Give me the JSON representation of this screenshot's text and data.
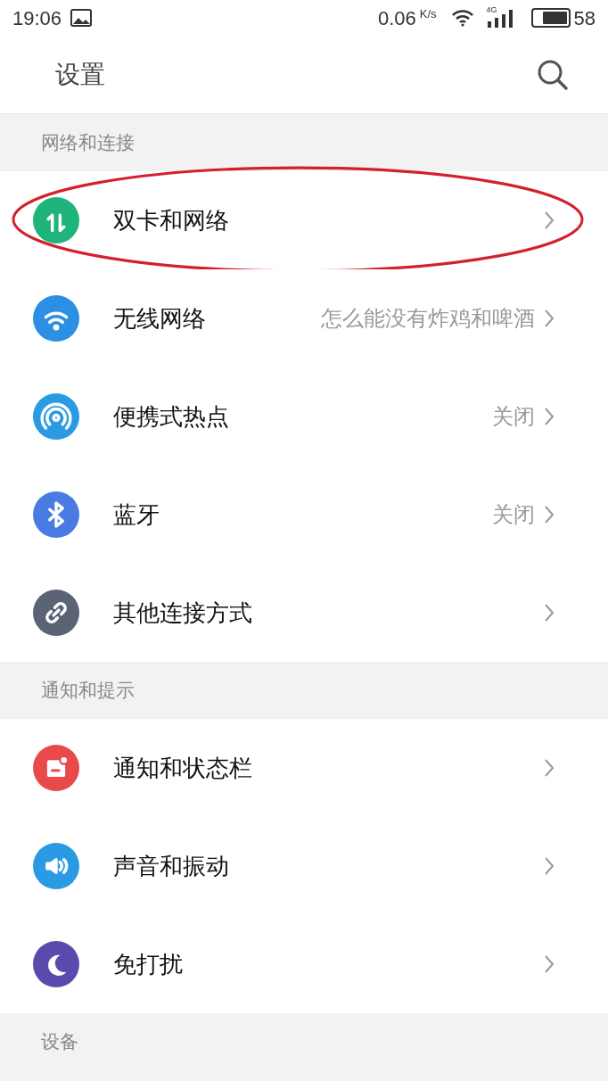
{
  "status_bar": {
    "time": "19:06",
    "speed": "0.06",
    "speed_unit": "K/s",
    "network_type": "4G",
    "battery": "58",
    "battery_meter": {
      "level": 0.75
    }
  },
  "header": {
    "title": "设置"
  },
  "sections": [
    {
      "title": "网络和连接",
      "items": [
        {
          "kind": "data",
          "color": "#1fb57a",
          "label": "双卡和网络",
          "circled": true
        },
        {
          "kind": "wifi",
          "color": "#2b8fe3",
          "label": "无线网络",
          "value": "怎么能没有炸鸡和啤酒",
          "circled": false
        },
        {
          "kind": "hotspot",
          "color": "#2a9ae3",
          "label": "便携式热点",
          "value": "关闭",
          "circled": false
        },
        {
          "kind": "bluetooth",
          "color": "#4a7be3",
          "label": "蓝牙",
          "value": "关闭",
          "circled": false
        },
        {
          "kind": "link",
          "color": "#5a6475",
          "label": "其他连接方式",
          "circled": false
        }
      ]
    },
    {
      "title": "通知和提示",
      "items": [
        {
          "kind": "notice",
          "color": "#e84a4a",
          "label": "通知和状态栏",
          "circled": false
        },
        {
          "kind": "sound",
          "color": "#2a9ae3",
          "label": "声音和振动",
          "circled": false
        },
        {
          "kind": "moon",
          "color": "#5a4aae",
          "label": "免打扰",
          "circled": false
        }
      ]
    },
    {
      "title": "设备"
    }
  ]
}
